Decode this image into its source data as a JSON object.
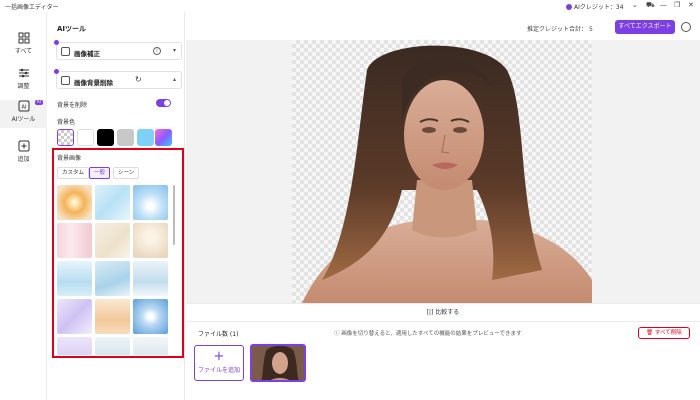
{
  "app": {
    "title": "一括画像エディター"
  },
  "titlebar": {
    "credits_label": "AIクレジット：",
    "credits_value": "34"
  },
  "rail": [
    {
      "label": "すべて",
      "icon": "grid-icon"
    },
    {
      "label": "調整",
      "icon": "sliders-icon"
    },
    {
      "label": "AIツール",
      "icon": "ai-tools-icon",
      "badge": "AI"
    },
    {
      "label": "追加",
      "icon": "add-square-icon"
    }
  ],
  "panel": {
    "title": "AIツール",
    "tools": [
      {
        "label": "画像補正"
      },
      {
        "label": "画像背景削除"
      }
    ],
    "remove_bg_label": "背景を削除",
    "remove_bg_on": true,
    "bg_color_label": "背景色",
    "bg_colors": [
      "transparent",
      "#ffffff",
      "#000000",
      "#c8c8c8",
      "#7fd0f7",
      "gradient"
    ],
    "bg_image_label": "背景画像",
    "tabs": [
      "カスタム",
      "一般",
      "シーン"
    ],
    "active_tab": "一般"
  },
  "toolbar": {
    "estimate_label": "推定クレジット合計：",
    "estimate_value": "5",
    "export_label": "すべてエクスポート"
  },
  "compare": {
    "label": "比較する"
  },
  "files": {
    "count_label": "ファイル数 (1)",
    "hint": "画像を切り替えると、適用したすべての機能の結果をプレビューできます",
    "delete_all": "すべて削除",
    "add_label": "ファイルを追加"
  }
}
